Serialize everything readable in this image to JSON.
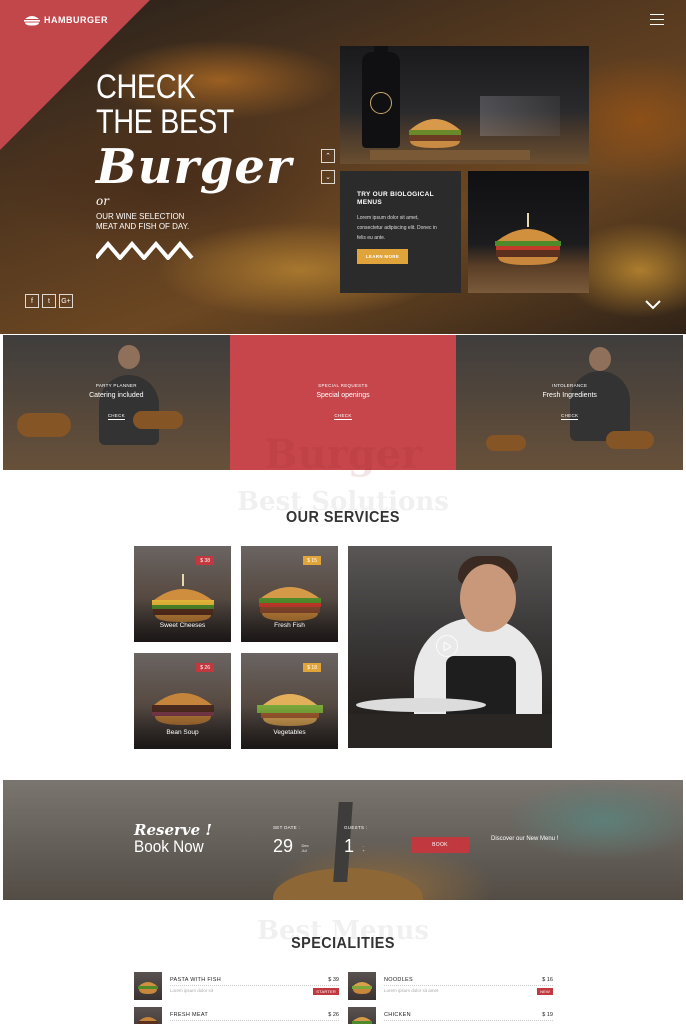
{
  "brand": {
    "name": "HAMBURGER",
    "accent": "#c1474b",
    "gold": "#e0a43a"
  },
  "hero": {
    "line1": "CHECK",
    "line2": "THE BEST",
    "script_word": "Burger",
    "or": "or",
    "sub": "OUR WINE SELECTION MEAT AND FISH OF DAY.",
    "social": [
      {
        "icon": "facebook-icon",
        "glyph": "f"
      },
      {
        "icon": "twitter-icon",
        "glyph": "t"
      },
      {
        "icon": "google-plus-icon",
        "glyph": "G+"
      }
    ],
    "card": {
      "title": "TRY OUR BIOLOGICAL MENUS",
      "text": "Lorem ipsum dolor sit amet, consectetur adipiscing elit. Donec in felis eu ante.",
      "button": "LEARN MORE"
    }
  },
  "strip": [
    {
      "eyebrow": "PARTY PLANNER",
      "title": "Catering included",
      "link": "CHECK"
    },
    {
      "eyebrow": "SPECIAL REQUESTS",
      "title": "Special openings",
      "link": "CHECK"
    },
    {
      "eyebrow": "INTOLERANCE",
      "title": "Fresh Ingredients",
      "link": "CHECK"
    }
  ],
  "services": {
    "ghost_top": "Burger",
    "ghost": "Best Solutions",
    "title": "OUR SERVICES",
    "items": [
      {
        "name": "Sweet Cheeses",
        "price": "$ 38",
        "badge_color": "#c1393f"
      },
      {
        "name": "Fresh Fish",
        "price": "$ 15",
        "badge_color": "#e0a43a"
      },
      {
        "name": "Bean Soup",
        "price": "$ 26",
        "badge_color": "#c1393f"
      },
      {
        "name": "Vegetables",
        "price": "$ 18",
        "badge_color": "#e0a43a"
      }
    ]
  },
  "booking": {
    "reserve": "Reserve !",
    "book_now": "Book Now",
    "date_label": "SET DATE :",
    "date_day": "29",
    "date_extra": [
      "Dec",
      "Jul"
    ],
    "guests_label": "GUESTS :",
    "guests_value": "1",
    "guests_extra": [
      "-",
      "+"
    ],
    "button": "BOOK",
    "discover": "Discover our New Menu !"
  },
  "specialities": {
    "ghost": "Best Menus",
    "title": "SPECIALITIES",
    "items": [
      {
        "name": "PASTA WITH FISH",
        "price": "$ 39",
        "desc": "Lorem ipsum dolor sit",
        "badge": "STARTER"
      },
      {
        "name": "NOODLES",
        "price": "$ 16",
        "desc": "Lorem ipsum dolor sit amet",
        "badge": "NEW"
      },
      {
        "name": "FRESH MEAT",
        "price": "$ 26",
        "desc": "",
        "badge": ""
      },
      {
        "name": "CHICKEN",
        "price": "$ 19",
        "desc": "",
        "badge": ""
      }
    ]
  }
}
